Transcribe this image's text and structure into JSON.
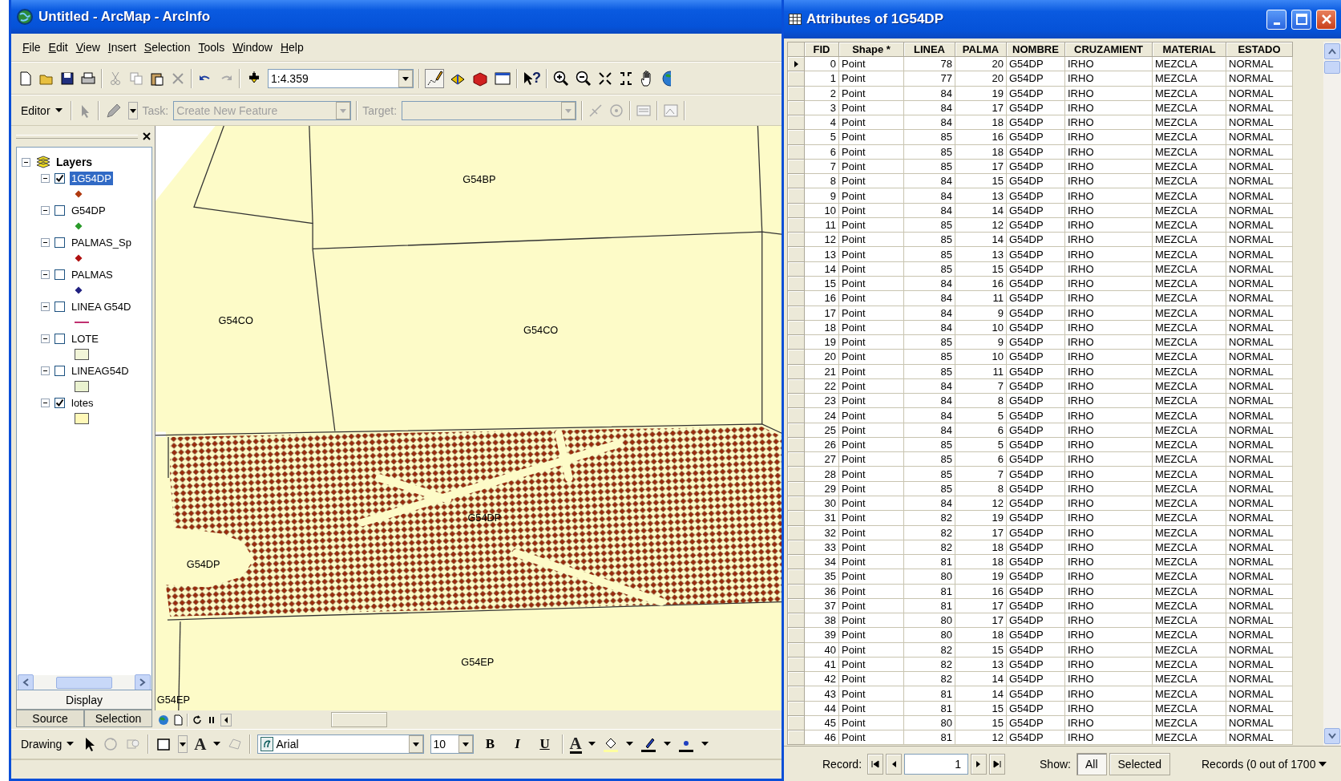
{
  "arcmap": {
    "title": "Untitled - ArcMap - ArcInfo",
    "menu": [
      "File",
      "Edit",
      "View",
      "Insert",
      "Selection",
      "Tools",
      "Window",
      "Help"
    ],
    "scale": "1:4.359",
    "help_glyph": "?",
    "editor": {
      "label": "Editor",
      "task_label": "Task:",
      "task": "Create New Feature",
      "target_label": "Target:"
    },
    "toc": {
      "root": "Layers",
      "layers": [
        {
          "name": "1G54DP",
          "checked": true,
          "selected": true,
          "symbol": {
            "kind": "point",
            "color": "#b03a10"
          }
        },
        {
          "name": "G54DP",
          "checked": false,
          "selected": false,
          "symbol": {
            "kind": "point",
            "color": "#2a9a2a"
          }
        },
        {
          "name": "PALMAS_Sp",
          "checked": false,
          "selected": false,
          "symbol": {
            "kind": "point",
            "color": "#b01010"
          }
        },
        {
          "name": "PALMAS",
          "checked": false,
          "selected": false,
          "symbol": {
            "kind": "point",
            "color": "#202080"
          }
        },
        {
          "name": "LINEA G54D",
          "checked": false,
          "selected": false,
          "symbol": {
            "kind": "line",
            "color": "#c03070"
          }
        },
        {
          "name": "LOTE",
          "checked": false,
          "selected": false,
          "symbol": {
            "kind": "fill",
            "color": "#f2f5d8"
          }
        },
        {
          "name": "LINEAG54D",
          "checked": false,
          "selected": false,
          "symbol": {
            "kind": "fill",
            "color": "#eaf2d0"
          }
        },
        {
          "name": "lotes",
          "checked": true,
          "selected": false,
          "symbol": {
            "kind": "fill",
            "color": "#fff8b8"
          }
        }
      ],
      "tabs": [
        {
          "label": "Display",
          "selected": true
        },
        {
          "label": "Source",
          "selected": false
        },
        {
          "label": "Selection",
          "selected": false
        }
      ]
    },
    "map": {
      "labels": [
        "G54BP",
        "G54CO",
        "G54CO",
        "G54DP",
        "G54DP",
        "G54EP",
        "G54EP"
      ]
    },
    "drawing": {
      "label": "Drawing",
      "text_tool": "A",
      "font": "Arial",
      "size": "10",
      "bold": "B",
      "italic": "I",
      "underline": "U",
      "font_color": "A"
    }
  },
  "attributes": {
    "title": "Attributes of 1G54DP",
    "columns": [
      {
        "label": "FID",
        "kind": "number"
      },
      {
        "label": "Shape *",
        "kind": "text"
      },
      {
        "label": "LINEA",
        "kind": "number"
      },
      {
        "label": "PALMA",
        "kind": "number"
      },
      {
        "label": "NOMBRE",
        "kind": "text"
      },
      {
        "label": "CRUZAMIENT",
        "kind": "text"
      },
      {
        "label": "MATERIAL",
        "kind": "text"
      },
      {
        "label": "ESTADO",
        "kind": "text"
      }
    ],
    "rows": [
      {
        "current": true,
        "cells": [
          "0",
          "Point",
          "78",
          "20",
          "G54DP",
          "IRHO",
          "MEZCLA",
          "NORMAL"
        ]
      },
      {
        "current": false,
        "cells": [
          "1",
          "Point",
          "77",
          "20",
          "G54DP",
          "IRHO",
          "MEZCLA",
          "NORMAL"
        ]
      },
      {
        "current": false,
        "cells": [
          "2",
          "Point",
          "84",
          "19",
          "G54DP",
          "IRHO",
          "MEZCLA",
          "NORMAL"
        ]
      },
      {
        "current": false,
        "cells": [
          "3",
          "Point",
          "84",
          "17",
          "G54DP",
          "IRHO",
          "MEZCLA",
          "NORMAL"
        ]
      },
      {
        "current": false,
        "cells": [
          "4",
          "Point",
          "84",
          "18",
          "G54DP",
          "IRHO",
          "MEZCLA",
          "NORMAL"
        ]
      },
      {
        "current": false,
        "cells": [
          "5",
          "Point",
          "85",
          "16",
          "G54DP",
          "IRHO",
          "MEZCLA",
          "NORMAL"
        ]
      },
      {
        "current": false,
        "cells": [
          "6",
          "Point",
          "85",
          "18",
          "G54DP",
          "IRHO",
          "MEZCLA",
          "NORMAL"
        ]
      },
      {
        "current": false,
        "cells": [
          "7",
          "Point",
          "85",
          "17",
          "G54DP",
          "IRHO",
          "MEZCLA",
          "NORMAL"
        ]
      },
      {
        "current": false,
        "cells": [
          "8",
          "Point",
          "84",
          "15",
          "G54DP",
          "IRHO",
          "MEZCLA",
          "NORMAL"
        ]
      },
      {
        "current": false,
        "cells": [
          "9",
          "Point",
          "84",
          "13",
          "G54DP",
          "IRHO",
          "MEZCLA",
          "NORMAL"
        ]
      },
      {
        "current": false,
        "cells": [
          "10",
          "Point",
          "84",
          "14",
          "G54DP",
          "IRHO",
          "MEZCLA",
          "NORMAL"
        ]
      },
      {
        "current": false,
        "cells": [
          "11",
          "Point",
          "85",
          "12",
          "G54DP",
          "IRHO",
          "MEZCLA",
          "NORMAL"
        ]
      },
      {
        "current": false,
        "cells": [
          "12",
          "Point",
          "85",
          "14",
          "G54DP",
          "IRHO",
          "MEZCLA",
          "NORMAL"
        ]
      },
      {
        "current": false,
        "cells": [
          "13",
          "Point",
          "85",
          "13",
          "G54DP",
          "IRHO",
          "MEZCLA",
          "NORMAL"
        ]
      },
      {
        "current": false,
        "cells": [
          "14",
          "Point",
          "85",
          "15",
          "G54DP",
          "IRHO",
          "MEZCLA",
          "NORMAL"
        ]
      },
      {
        "current": false,
        "cells": [
          "15",
          "Point",
          "84",
          "16",
          "G54DP",
          "IRHO",
          "MEZCLA",
          "NORMAL"
        ]
      },
      {
        "current": false,
        "cells": [
          "16",
          "Point",
          "84",
          "11",
          "G54DP",
          "IRHO",
          "MEZCLA",
          "NORMAL"
        ]
      },
      {
        "current": false,
        "cells": [
          "17",
          "Point",
          "84",
          "9",
          "G54DP",
          "IRHO",
          "MEZCLA",
          "NORMAL"
        ]
      },
      {
        "current": false,
        "cells": [
          "18",
          "Point",
          "84",
          "10",
          "G54DP",
          "IRHO",
          "MEZCLA",
          "NORMAL"
        ]
      },
      {
        "current": false,
        "cells": [
          "19",
          "Point",
          "85",
          "9",
          "G54DP",
          "IRHO",
          "MEZCLA",
          "NORMAL"
        ]
      },
      {
        "current": false,
        "cells": [
          "20",
          "Point",
          "85",
          "10",
          "G54DP",
          "IRHO",
          "MEZCLA",
          "NORMAL"
        ]
      },
      {
        "current": false,
        "cells": [
          "21",
          "Point",
          "85",
          "11",
          "G54DP",
          "IRHO",
          "MEZCLA",
          "NORMAL"
        ]
      },
      {
        "current": false,
        "cells": [
          "22",
          "Point",
          "84",
          "7",
          "G54DP",
          "IRHO",
          "MEZCLA",
          "NORMAL"
        ]
      },
      {
        "current": false,
        "cells": [
          "23",
          "Point",
          "84",
          "8",
          "G54DP",
          "IRHO",
          "MEZCLA",
          "NORMAL"
        ]
      },
      {
        "current": false,
        "cells": [
          "24",
          "Point",
          "84",
          "5",
          "G54DP",
          "IRHO",
          "MEZCLA",
          "NORMAL"
        ]
      },
      {
        "current": false,
        "cells": [
          "25",
          "Point",
          "84",
          "6",
          "G54DP",
          "IRHO",
          "MEZCLA",
          "NORMAL"
        ]
      },
      {
        "current": false,
        "cells": [
          "26",
          "Point",
          "85",
          "5",
          "G54DP",
          "IRHO",
          "MEZCLA",
          "NORMAL"
        ]
      },
      {
        "current": false,
        "cells": [
          "27",
          "Point",
          "85",
          "6",
          "G54DP",
          "IRHO",
          "MEZCLA",
          "NORMAL"
        ]
      },
      {
        "current": false,
        "cells": [
          "28",
          "Point",
          "85",
          "7",
          "G54DP",
          "IRHO",
          "MEZCLA",
          "NORMAL"
        ]
      },
      {
        "current": false,
        "cells": [
          "29",
          "Point",
          "85",
          "8",
          "G54DP",
          "IRHO",
          "MEZCLA",
          "NORMAL"
        ]
      },
      {
        "current": false,
        "cells": [
          "30",
          "Point",
          "84",
          "12",
          "G54DP",
          "IRHO",
          "MEZCLA",
          "NORMAL"
        ]
      },
      {
        "current": false,
        "cells": [
          "31",
          "Point",
          "82",
          "19",
          "G54DP",
          "IRHO",
          "MEZCLA",
          "NORMAL"
        ]
      },
      {
        "current": false,
        "cells": [
          "32",
          "Point",
          "82",
          "17",
          "G54DP",
          "IRHO",
          "MEZCLA",
          "NORMAL"
        ]
      },
      {
        "current": false,
        "cells": [
          "33",
          "Point",
          "82",
          "18",
          "G54DP",
          "IRHO",
          "MEZCLA",
          "NORMAL"
        ]
      },
      {
        "current": false,
        "cells": [
          "34",
          "Point",
          "81",
          "18",
          "G54DP",
          "IRHO",
          "MEZCLA",
          "NORMAL"
        ]
      },
      {
        "current": false,
        "cells": [
          "35",
          "Point",
          "80",
          "19",
          "G54DP",
          "IRHO",
          "MEZCLA",
          "NORMAL"
        ]
      },
      {
        "current": false,
        "cells": [
          "36",
          "Point",
          "81",
          "16",
          "G54DP",
          "IRHO",
          "MEZCLA",
          "NORMAL"
        ]
      },
      {
        "current": false,
        "cells": [
          "37",
          "Point",
          "81",
          "17",
          "G54DP",
          "IRHO",
          "MEZCLA",
          "NORMAL"
        ]
      },
      {
        "current": false,
        "cells": [
          "38",
          "Point",
          "80",
          "17",
          "G54DP",
          "IRHO",
          "MEZCLA",
          "NORMAL"
        ]
      },
      {
        "current": false,
        "cells": [
          "39",
          "Point",
          "80",
          "18",
          "G54DP",
          "IRHO",
          "MEZCLA",
          "NORMAL"
        ]
      },
      {
        "current": false,
        "cells": [
          "40",
          "Point",
          "82",
          "15",
          "G54DP",
          "IRHO",
          "MEZCLA",
          "NORMAL"
        ]
      },
      {
        "current": false,
        "cells": [
          "41",
          "Point",
          "82",
          "13",
          "G54DP",
          "IRHO",
          "MEZCLA",
          "NORMAL"
        ]
      },
      {
        "current": false,
        "cells": [
          "42",
          "Point",
          "82",
          "14",
          "G54DP",
          "IRHO",
          "MEZCLA",
          "NORMAL"
        ]
      },
      {
        "current": false,
        "cells": [
          "43",
          "Point",
          "81",
          "14",
          "G54DP",
          "IRHO",
          "MEZCLA",
          "NORMAL"
        ]
      },
      {
        "current": false,
        "cells": [
          "44",
          "Point",
          "81",
          "15",
          "G54DP",
          "IRHO",
          "MEZCLA",
          "NORMAL"
        ]
      },
      {
        "current": false,
        "cells": [
          "45",
          "Point",
          "80",
          "15",
          "G54DP",
          "IRHO",
          "MEZCLA",
          "NORMAL"
        ]
      },
      {
        "current": false,
        "cells": [
          "46",
          "Point",
          "81",
          "12",
          "G54DP",
          "IRHO",
          "MEZCLA",
          "NORMAL"
        ]
      }
    ],
    "footer": {
      "record_label": "Record:",
      "record": "1",
      "show_label": "Show:",
      "show_options": [
        {
          "label": "All",
          "selected": true
        },
        {
          "label": "Selected",
          "selected": false
        }
      ],
      "summary": "Records (0 out of 1700"
    }
  }
}
